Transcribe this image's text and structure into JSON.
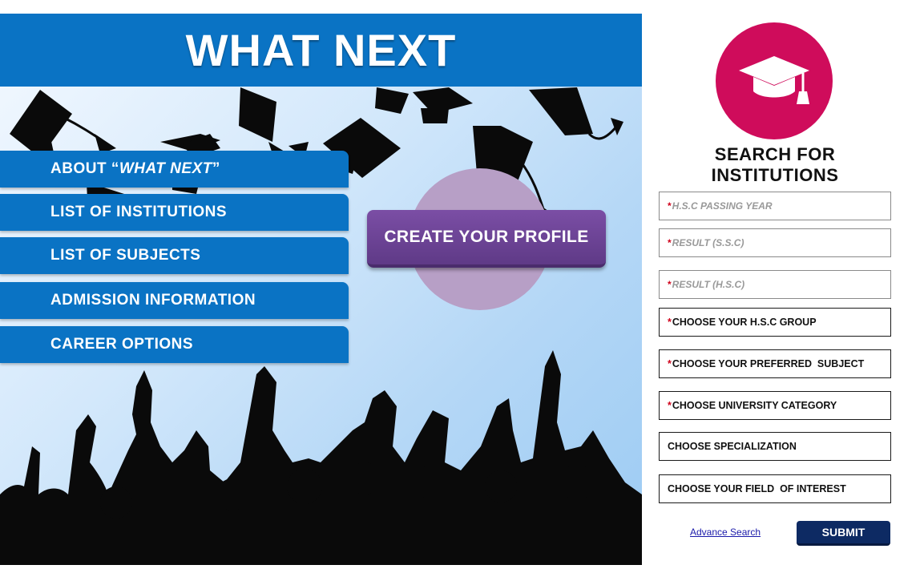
{
  "hero": {
    "title": "WHAT NEXT",
    "nav": [
      {
        "prefix": "ABOUT “",
        "emphasis": "WHAT NEXT",
        "suffix": "”"
      },
      {
        "label": "LIST OF INSTITUTIONS"
      },
      {
        "label": "LIST OF SUBJECTS"
      },
      {
        "label": "ADMISSION INFORMATION"
      },
      {
        "label": "CAREER OPTIONS"
      }
    ],
    "create_profile_label": "CREATE YOUR PROFILE",
    "illustration": "graduates-throwing-caps-silhouette"
  },
  "search": {
    "icon": "graduation-cap-icon",
    "heading": "SEARCH FOR INSTITUTIONS",
    "fields": [
      {
        "required": "*",
        "placeholder": "H.S.C PASSING YEAR",
        "value": ""
      },
      {
        "required": "*",
        "placeholder": "RESULT (S.S.C)",
        "value": ""
      },
      {
        "required": "*",
        "placeholder": "RESULT (H.S.C)",
        "value": ""
      }
    ],
    "selects": [
      {
        "required": "*",
        "label": "CHOOSE YOUR H.S.C GROUP"
      },
      {
        "required": "*",
        "label": "CHOOSE YOUR PREFERRED  SUBJECT"
      },
      {
        "required": "*",
        "label": "CHOOSE UNIVERSITY CATEGORY"
      },
      {
        "required": "",
        "label": "CHOOSE SPECIALIZATION"
      },
      {
        "required": "",
        "label": "CHOOSE YOUR FIELD  OF INTEREST"
      }
    ],
    "advance_search_label": "Advance Search",
    "submit_label": "SUBMIT"
  },
  "colors": {
    "banner_blue": "#0a73c4",
    "profile_purple": "#6c4496",
    "cap_circle_pink": "#cf0c5b",
    "submit_navy": "#0d2a63",
    "required_red": "#d0021b"
  }
}
